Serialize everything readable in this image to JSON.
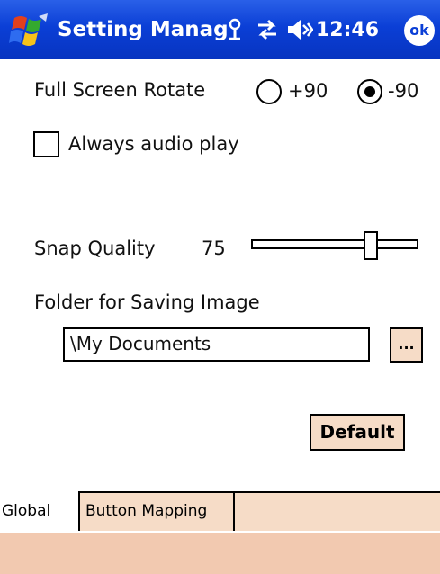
{
  "window": {
    "title": "Setting Manag",
    "time": "12:46",
    "ok_label": "ok",
    "accent_color": "#0b3fd6"
  },
  "status_icons": [
    "windows-flag-icon",
    "connectivity-icon",
    "sync-arrows-icon",
    "volume-icon"
  ],
  "settings": {
    "rotate_label": "Full Screen Rotate",
    "rotate_options": [
      {
        "label": "+90",
        "selected": false
      },
      {
        "label": "-90",
        "selected": true
      }
    ],
    "audio_checkbox_label": "Always audio play",
    "audio_checked": false,
    "snap_quality_label": "Snap Quality",
    "snap_quality_value": "75",
    "folder_label": "Folder for Saving Image",
    "folder_value": "\\My Documents",
    "browse_label": "...",
    "default_label": "Default"
  },
  "tabs": [
    {
      "label": "Global",
      "active": true
    },
    {
      "label": "Button Mapping",
      "active": false
    }
  ],
  "colors": {
    "button_bg": "#f6dcc7",
    "menubar_bg": "#f2c9b0"
  }
}
